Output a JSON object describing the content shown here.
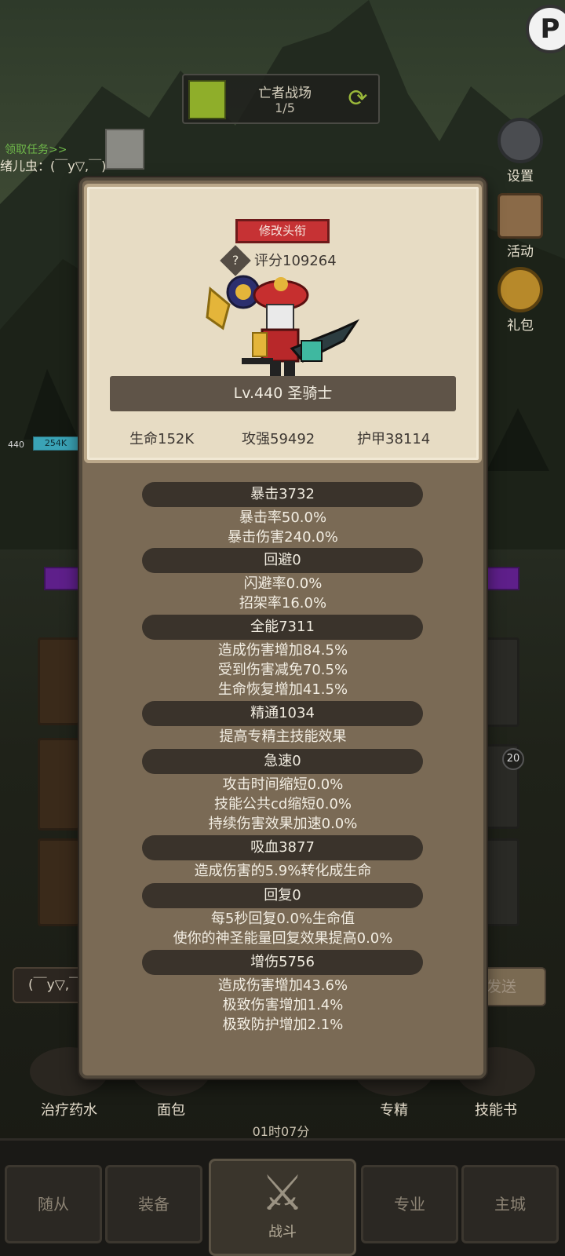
{
  "stage": {
    "title": "亡者战场",
    "progress": "1/5"
  },
  "chat": {
    "quest_link": "领取任务>>",
    "message": "绪儿虫：(￣y▽,￣)"
  },
  "side_menu": [
    {
      "label": "设置",
      "icon": "gear-icon"
    },
    {
      "label": "活动",
      "icon": "activity-board-icon"
    },
    {
      "label": "礼包",
      "icon": "gift-pot-icon"
    }
  ],
  "battle": {
    "level_tag": "440",
    "hp_text": "254K"
  },
  "right_slot_badge": "20",
  "chat_input": {
    "value": "(￣y▽,￣)",
    "send_label": "发送"
  },
  "item_bar": [
    {
      "label": "治疗药水",
      "icon": "potion-icon"
    },
    {
      "label": "面包",
      "icon": "bread-icon"
    },
    {
      "label": "专精",
      "icon": "specialization-icon"
    },
    {
      "label": "技能书",
      "icon": "skill-book-icon"
    }
  ],
  "timer": "01时07分",
  "bottom_nav": [
    {
      "label": "随从"
    },
    {
      "label": "装备"
    },
    {
      "label": "战斗"
    },
    {
      "label": "专业"
    },
    {
      "label": "主城"
    }
  ],
  "profile": {
    "rename_label": "修改头衔",
    "score": "评分109264",
    "level_class": "Lv.440 圣骑士",
    "hp": "生命152K",
    "attack": "攻强59492",
    "armor": "护甲38114"
  },
  "stats": [
    {
      "header": "暴击3732",
      "lines": [
        "暴击率50.0%",
        "暴击伤害240.0%"
      ]
    },
    {
      "header": "回避0",
      "lines": [
        "闪避率0.0%",
        "招架率16.0%"
      ]
    },
    {
      "header": "全能7311",
      "lines": [
        "造成伤害增加84.5%",
        "受到伤害减免70.5%",
        "生命恢复增加41.5%"
      ]
    },
    {
      "header": "精通1034",
      "lines": [
        "提高专精主技能效果"
      ]
    },
    {
      "header": "急速0",
      "lines": [
        "攻击时间缩短0.0%",
        "技能公共cd缩短0.0%",
        "持续伤害效果加速0.0%"
      ]
    },
    {
      "header": "吸血3877",
      "lines": [
        "造成伤害的5.9%转化成生命"
      ]
    },
    {
      "header": "回复0",
      "lines": [
        "每5秒回复0.0%生命值",
        "使你的神圣能量回复效果提高0.0%"
      ]
    },
    {
      "header": "增伤5756",
      "lines": [
        "造成伤害增加43.6%",
        "极致伤害增加1.4%",
        "极致防护增加2.1%"
      ]
    }
  ],
  "colors": {
    "panel": "#7a6a55",
    "card": "#e7dcc4",
    "stat_header": "#3a332b",
    "rename_button": "#c63234",
    "stage_swatch": "#8fae2a"
  }
}
